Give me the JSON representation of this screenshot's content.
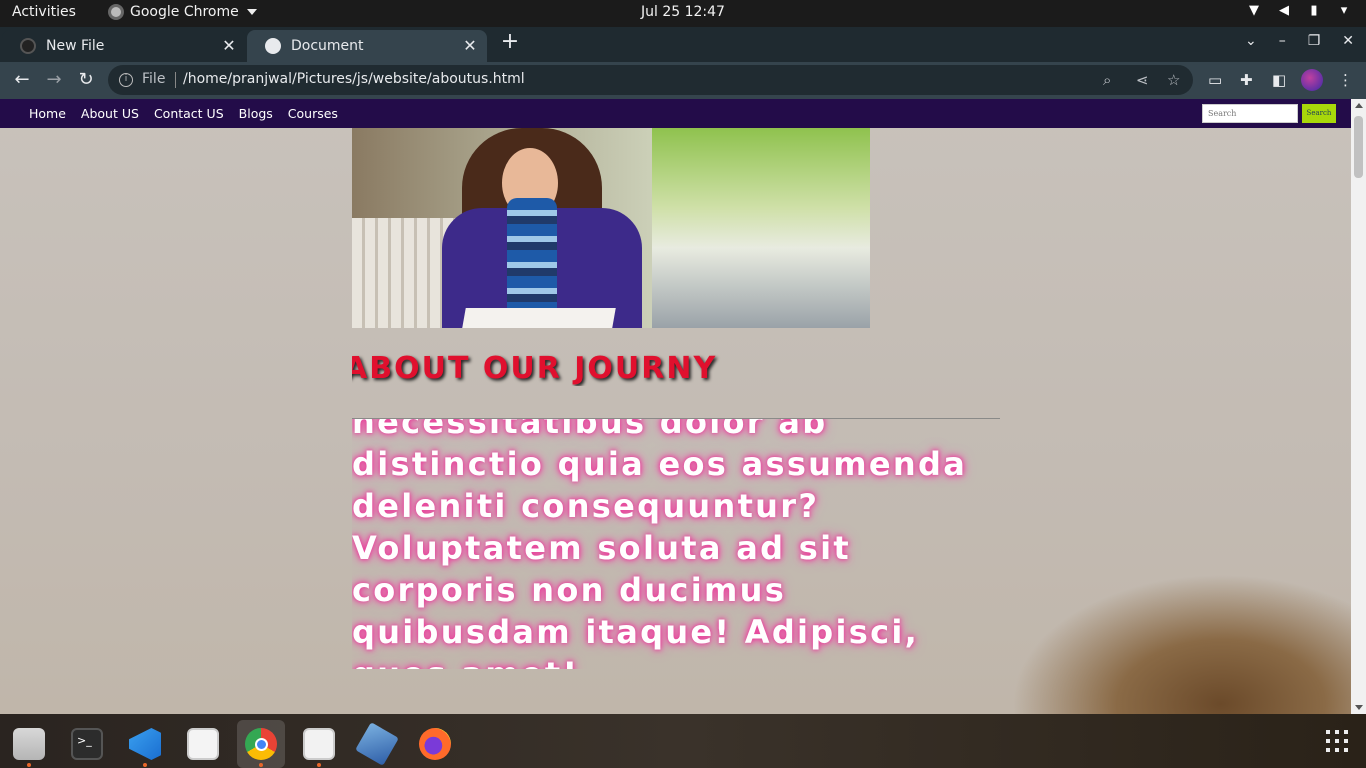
{
  "topbar": {
    "activities": "Activities",
    "app_name": "Google Chrome",
    "clock": "Jul 25  12:47"
  },
  "tabs": [
    {
      "title": "New File",
      "active": false
    },
    {
      "title": "Document",
      "active": true
    }
  ],
  "omnibox": {
    "scheme": "File",
    "url": "/home/pranjwal/Pictures/js/website/aboutus.html"
  },
  "site": {
    "nav": [
      "Home",
      "About US",
      "Contact US",
      "Blogs",
      "Courses"
    ],
    "search_placeholder": "Search",
    "search_button": "Search",
    "about_title": "ABOUT OUR JOURNY",
    "about_body": "necessitatibus dolor ab distinctio quia eos assumenda deleniti consequuntur? Voluptatem soluta ad sit corporis non ducimus quibusdam itaque! Adipisci, quos amet!"
  },
  "colors": {
    "site_nav_bg": "#230c49",
    "title_red": "#e0102e",
    "search_btn": "#a8d80a",
    "glow_pink": "#e8409a"
  },
  "dock": {
    "apps": [
      "files-icon",
      "terminal-icon",
      "vscode-icon",
      "document-viewer-icon",
      "chrome-icon",
      "text-editor-icon",
      "virtualbox-icon",
      "firefox-icon"
    ]
  }
}
